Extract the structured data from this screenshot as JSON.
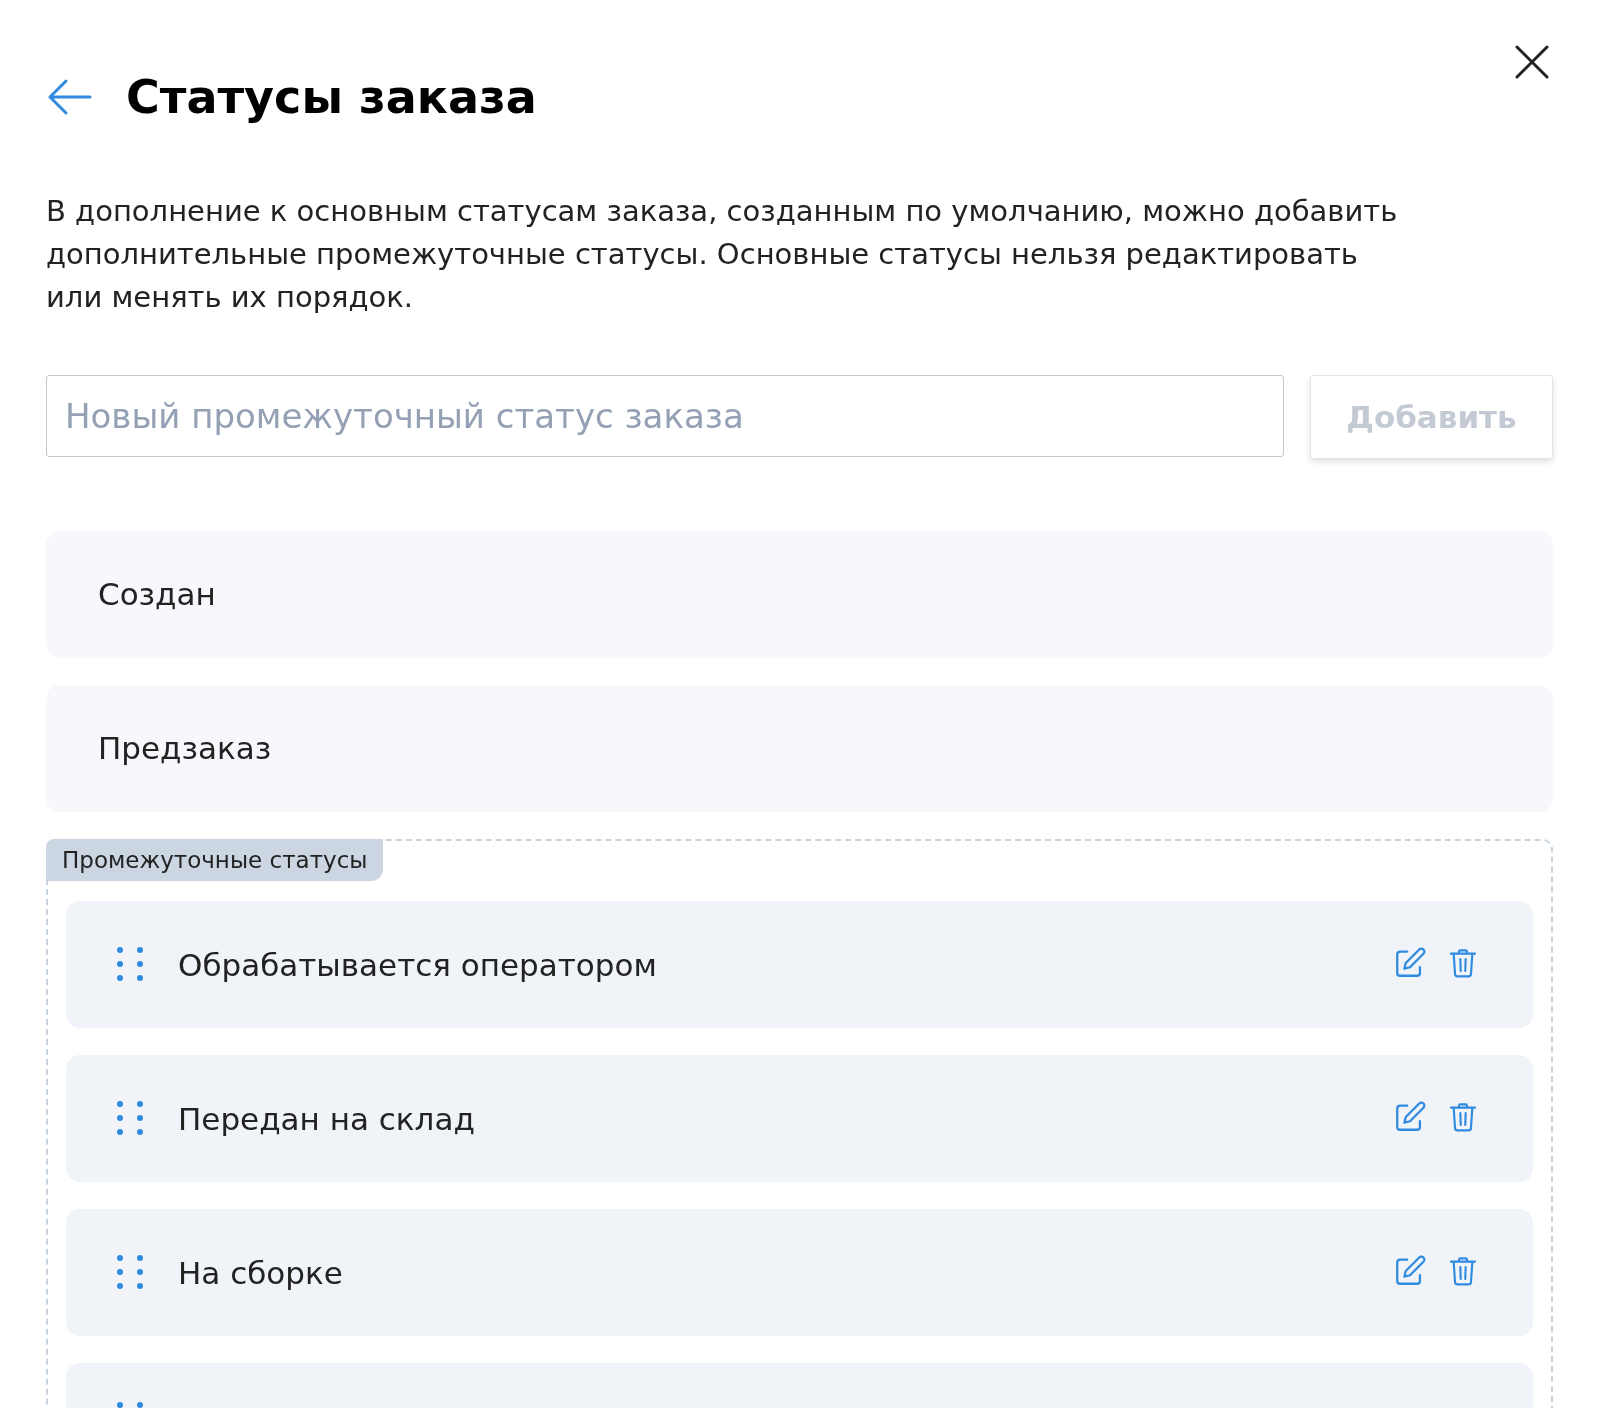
{
  "header": {
    "title": "Статусы заказа"
  },
  "description": "В дополнение к основным статусам заказа, созданным по умолчанию, можно добавить дополнительные промежуточные статусы. Основные статусы нельзя редактировать или менять их порядок.",
  "new_status": {
    "placeholder": "Новый промежуточный статус заказа",
    "button": "Добавить",
    "button_disabled": true
  },
  "base_statuses": [
    "Создан",
    "Предзаказ"
  ],
  "intermediate": {
    "label": "Промежуточные статусы",
    "items": [
      {
        "kind": "full",
        "name": "Обрабатывается оператором"
      },
      {
        "kind": "full",
        "name": "Передан на склад"
      },
      {
        "kind": "full",
        "name": "На сборке"
      },
      {
        "kind": "clipped"
      }
    ]
  }
}
